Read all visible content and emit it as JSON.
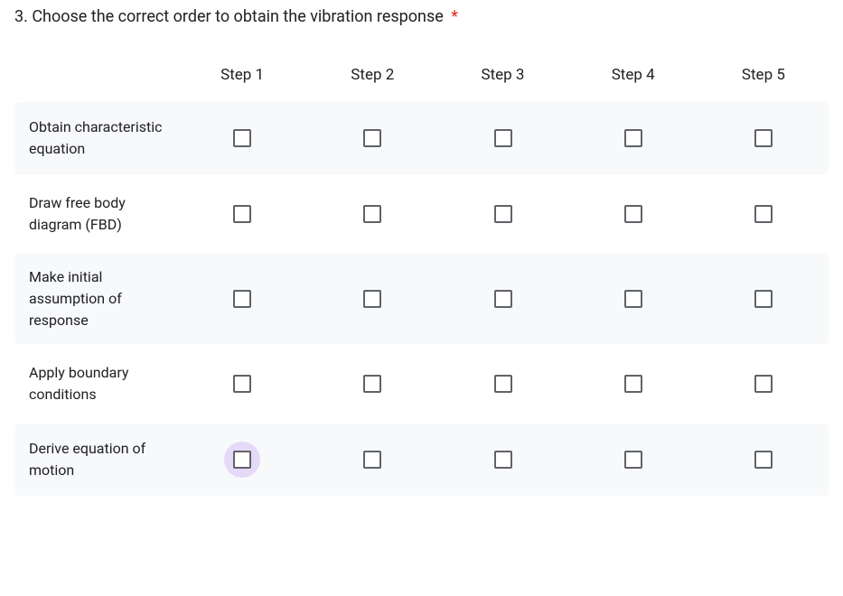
{
  "question": {
    "number": "3.",
    "text": "Choose the correct order to obtain the vibration response",
    "required_mark": "*"
  },
  "columns": [
    {
      "label": "Step 1"
    },
    {
      "label": "Step 2"
    },
    {
      "label": "Step 3"
    },
    {
      "label": "Step 4"
    },
    {
      "label": "Step 5"
    }
  ],
  "rows": [
    {
      "label": "Obtain characteristic equation"
    },
    {
      "label": "Draw free body diagram (FBD)"
    },
    {
      "label": "Make initial assumption of response"
    },
    {
      "label": "Apply boundary conditions"
    },
    {
      "label": "Derive equation of motion"
    }
  ],
  "focused_cell": {
    "row": 4,
    "col": 0
  }
}
